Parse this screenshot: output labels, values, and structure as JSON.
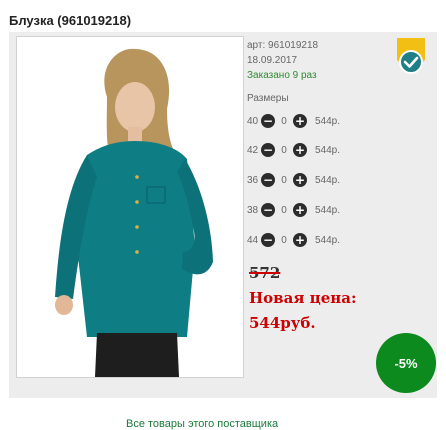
{
  "product": {
    "title": "Блузка (961019218)",
    "article": "арт: 961019218",
    "date": "18.09.2017",
    "ordered": "Заказано 9 раз"
  },
  "sizes": {
    "label": "Размеры",
    "rows": [
      {
        "size": "40",
        "qty": "0",
        "price": "544р."
      },
      {
        "size": "42",
        "qty": "0",
        "price": "544р."
      },
      {
        "size": "36",
        "qty": "0",
        "price": "544р."
      },
      {
        "size": "38",
        "qty": "0",
        "price": "544р."
      },
      {
        "size": "44",
        "qty": "0",
        "price": "544р."
      }
    ],
    "minus_glyph": "−",
    "plus_glyph": "+"
  },
  "pricing": {
    "old_price": "572",
    "new_label": "Новая цена:",
    "new_price": "544руб.",
    "discount": "-5%"
  },
  "links": {
    "supplier": "Все товары этого поставщика"
  },
  "colors": {
    "accent_red": "#cc0000",
    "discount_green": "#0c8a1e",
    "ordered_green": "#2e8b2e",
    "badge_yellow": "#f2bf14",
    "badge_teal": "#1f7f86"
  },
  "icons": {
    "verified_badge": "verified-check-badge-icon",
    "minus": "minus-circle-icon",
    "plus": "plus-circle-icon"
  }
}
